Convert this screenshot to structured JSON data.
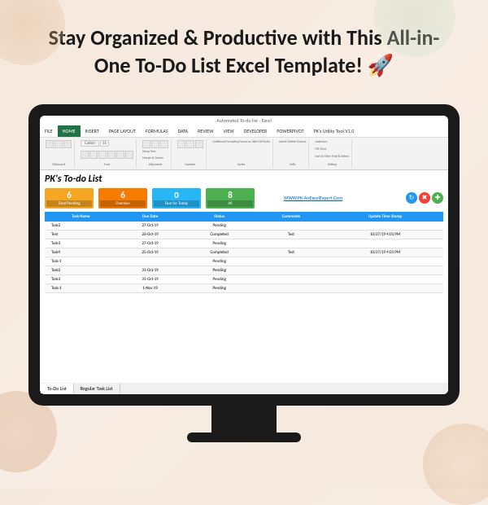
{
  "headline": "Stay Organized & Productive with This All-in-One To-Do List Excel Template! 🚀",
  "window_title": "Automated To-do list - Excel",
  "menu": [
    "FILE",
    "HOME",
    "INSERT",
    "PAGE LAYOUT",
    "FORMULAS",
    "DATA",
    "REVIEW",
    "VIEW",
    "DEVELOPER",
    "POWERPIVOT",
    "PK's Utility Tool V1.0"
  ],
  "active_menu": "HOME",
  "ribbon_groups": [
    "Clipboard",
    "Font",
    "Alignment",
    "Number",
    "Styles",
    "Cells",
    "Editing"
  ],
  "ribbon_items": {
    "autosum": "AutoSum",
    "fill": "Fill",
    "clear": "Clear",
    "sort": "Sort & Filter",
    "find": "Find & Select",
    "cond": "Conditional Formatting",
    "fmt": "Format as Table",
    "cell": "Cell Styles",
    "ins": "Insert",
    "del": "Delete",
    "format": "Format",
    "wrap": "Wrap Text",
    "merge": "Merge & Center"
  },
  "app_title": "PK's To-do List",
  "website": "WWW.PK-AnExcelExpert.Com",
  "stats": {
    "pending": {
      "value": "6",
      "label": "Total Pending"
    },
    "overdue": {
      "value": "6",
      "label": "Overdue"
    },
    "today": {
      "value": "0",
      "label": "Due for Today"
    },
    "all": {
      "value": "8",
      "label": "All"
    }
  },
  "columns": [
    "Task Name",
    "Due Date",
    "Status",
    "Comments",
    "Update Time Stamp"
  ],
  "rows": [
    {
      "task": "Task2",
      "due": "27-Oct-19",
      "status": "Pending",
      "comments": "",
      "ts": ""
    },
    {
      "task": "Test",
      "due": "26-Oct-19",
      "status": "Completed",
      "comments": "Test",
      "ts": "10/27/19 4:01 PM"
    },
    {
      "task": "Task3",
      "due": "27-Oct-19",
      "status": "Pending",
      "comments": "",
      "ts": ""
    },
    {
      "task": "Task4",
      "due": "25-Oct-19",
      "status": "Completed",
      "comments": "Test",
      "ts": "10/27/19 4:01 PM"
    },
    {
      "task": "Task-1",
      "due": "",
      "status": "Pending",
      "comments": "",
      "ts": ""
    },
    {
      "task": "Task2",
      "due": "31-Oct-19",
      "status": "Pending",
      "comments": "",
      "ts": ""
    },
    {
      "task": "Task3",
      "due": "31-Oct-19",
      "status": "Pending",
      "comments": "",
      "ts": ""
    },
    {
      "task": "Task-1",
      "due": "1-Nov-19",
      "status": "Pending",
      "comments": "",
      "ts": ""
    }
  ],
  "sheet_tabs": [
    "To-Do List",
    "Regular Task List"
  ],
  "active_tab": "To-Do List",
  "font_name": "Calibri",
  "font_size": "11"
}
